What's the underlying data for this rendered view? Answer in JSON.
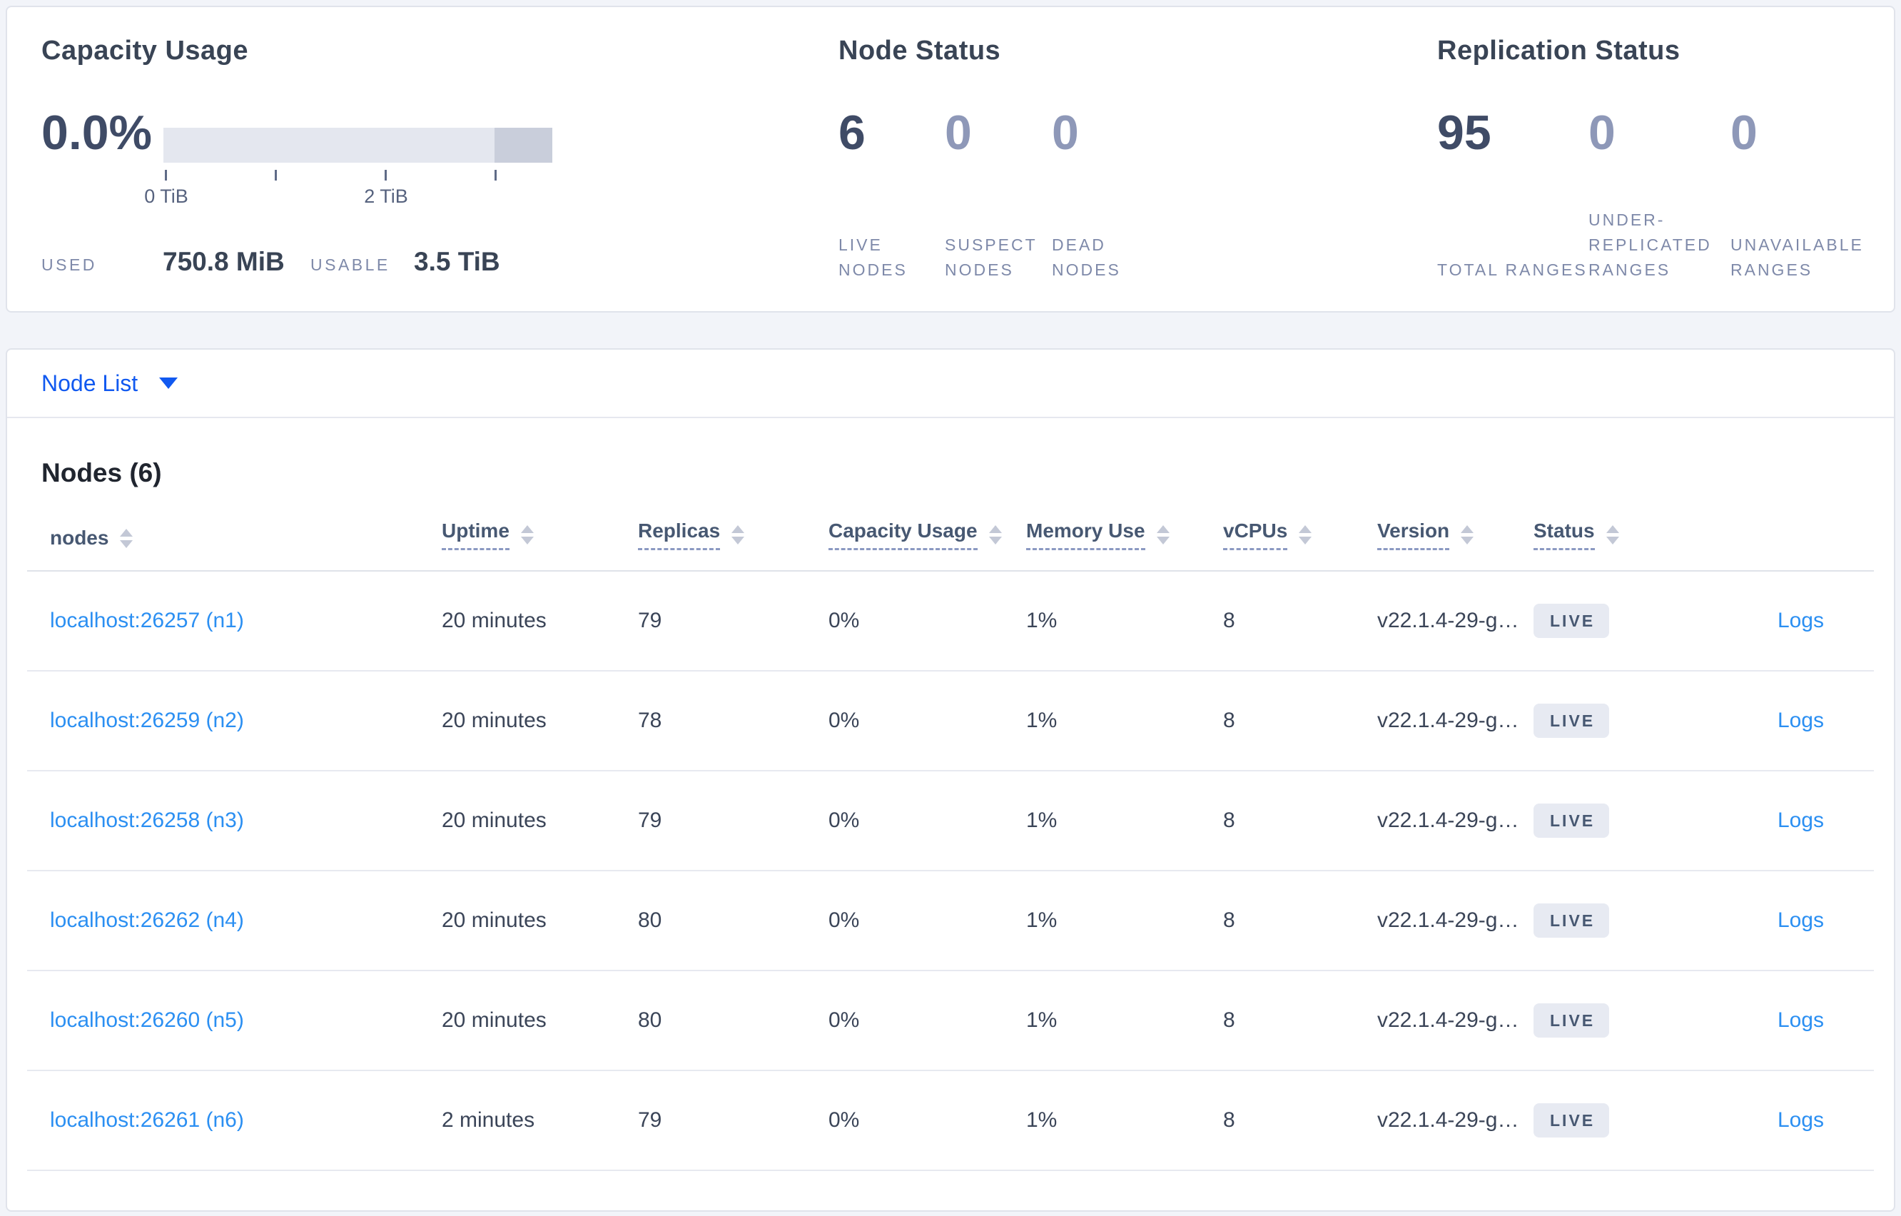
{
  "overview": {
    "capacity": {
      "title": "Capacity Usage",
      "percent": "0.0%",
      "tick_labels": [
        "0 TiB",
        "2 TiB"
      ],
      "used_label": "USED",
      "used_value": "750.8 MiB",
      "usable_label": "USABLE",
      "usable_value": "3.5 TiB"
    },
    "node_status": {
      "title": "Node Status",
      "stats": [
        {
          "value": "6",
          "label": "LIVE NODES"
        },
        {
          "value": "0",
          "label": "SUSPECT NODES"
        },
        {
          "value": "0",
          "label": "DEAD NODES"
        }
      ]
    },
    "replication": {
      "title": "Replication Status",
      "stats": [
        {
          "value": "95",
          "label": "TOTAL RANGES"
        },
        {
          "value": "0",
          "label": "UNDER-REPLICATED RANGES"
        },
        {
          "value": "0",
          "label": "UNAVAILABLE RANGES"
        }
      ]
    }
  },
  "node_list": {
    "dropdown_label": "Node List",
    "caret_icon": "caret-down-icon"
  },
  "table": {
    "section_title": "Nodes (6)",
    "columns": [
      {
        "label": "nodes"
      },
      {
        "label": "Uptime"
      },
      {
        "label": "Replicas"
      },
      {
        "label": "Capacity Usage"
      },
      {
        "label": "Memory Use"
      },
      {
        "label": "vCPUs"
      },
      {
        "label": "Version"
      },
      {
        "label": "Status"
      }
    ],
    "sort_icon": "sort-arrows-icon",
    "logs_label": "Logs",
    "rows": [
      {
        "node": "localhost:26257 (n1)",
        "uptime": "20 minutes",
        "replicas": "79",
        "capacity": "0%",
        "memory": "1%",
        "vcpus": "8",
        "version": "v22.1.4-29-g…",
        "status": "LIVE"
      },
      {
        "node": "localhost:26259 (n2)",
        "uptime": "20 minutes",
        "replicas": "78",
        "capacity": "0%",
        "memory": "1%",
        "vcpus": "8",
        "version": "v22.1.4-29-g…",
        "status": "LIVE"
      },
      {
        "node": "localhost:26258 (n3)",
        "uptime": "20 minutes",
        "replicas": "79",
        "capacity": "0%",
        "memory": "1%",
        "vcpus": "8",
        "version": "v22.1.4-29-g…",
        "status": "LIVE"
      },
      {
        "node": "localhost:26262 (n4)",
        "uptime": "20 minutes",
        "replicas": "80",
        "capacity": "0%",
        "memory": "1%",
        "vcpus": "8",
        "version": "v22.1.4-29-g…",
        "status": "LIVE"
      },
      {
        "node": "localhost:26260 (n5)",
        "uptime": "20 minutes",
        "replicas": "80",
        "capacity": "0%",
        "memory": "1%",
        "vcpus": "8",
        "version": "v22.1.4-29-g…",
        "status": "LIVE"
      },
      {
        "node": "localhost:26261 (n6)",
        "uptime": "2 minutes",
        "replicas": "79",
        "capacity": "0%",
        "memory": "1%",
        "vcpus": "8",
        "version": "v22.1.4-29-g…",
        "status": "LIVE"
      }
    ]
  },
  "colors": {
    "page_bg": "#f2f4f9",
    "card_border": "#e0e3eb",
    "heading_dark": "#394455",
    "stat_dark": "#3f4b66",
    "stat_muted": "#8e98b8",
    "label_muted": "#7e89a9",
    "link_primary": "#1159f0",
    "link_node": "#2b8ff2",
    "badge_bg": "#e7eaf2",
    "bar_light": "#e4e7ef",
    "bar_dark": "#c9cedb"
  }
}
